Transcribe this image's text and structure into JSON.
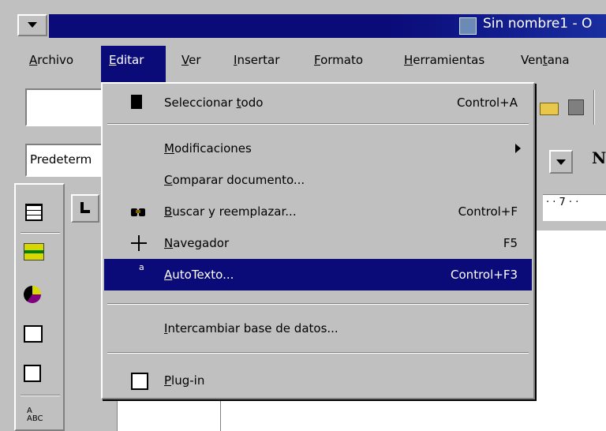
{
  "window": {
    "title": "Sin nombre1 - O"
  },
  "menubar": {
    "items": [
      "Archivo",
      "Editar",
      "Ver",
      "Insertar",
      "Formato",
      "Herramientas",
      "Ventana"
    ]
  },
  "toolbar": {
    "style_value": "Predeterm"
  },
  "ruler": {
    "text": "· · 7 · ·"
  },
  "font_preview": "N",
  "edit_menu": {
    "items": [
      {
        "label": "Seleccionar todo",
        "shortcut": "Control+A"
      },
      {
        "label": "Modificaciones",
        "shortcut": ""
      },
      {
        "label": "Comparar documento...",
        "shortcut": ""
      },
      {
        "label": "Buscar y reemplazar...",
        "shortcut": "Control+F"
      },
      {
        "label": "Navegador",
        "shortcut": "F5"
      },
      {
        "label": "AutoTexto...",
        "shortcut": "Control+F3"
      },
      {
        "label": "Intercambiar base de datos...",
        "shortcut": ""
      },
      {
        "label": "Plug-in",
        "shortcut": ""
      }
    ],
    "highlighted": "AutoTexto..."
  },
  "colors": {
    "titlebar": "#0a0a78",
    "highlight": "#0a0a78",
    "face": "#c0c0c0"
  }
}
